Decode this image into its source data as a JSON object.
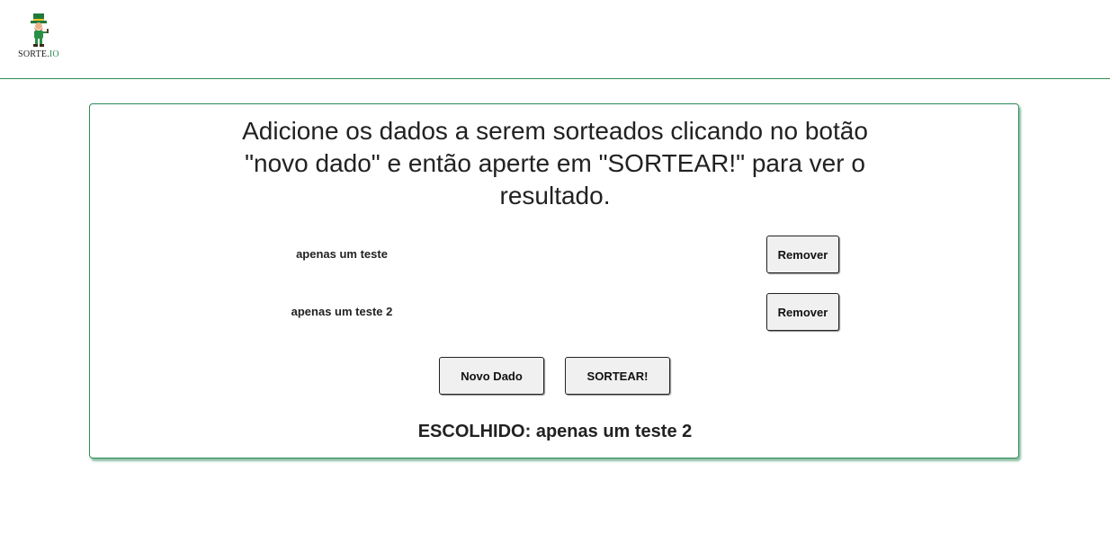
{
  "header": {
    "logo_text_main": "SORTE.",
    "logo_text_accent": "IO",
    "brand_color": "#2e8b57"
  },
  "main": {
    "instructions": "Adicione os dados a serem sorteados clicando no botão \"novo dado\" e então aperte em \"SORTEAR!\" para ver o resultado.",
    "items": [
      {
        "label": "apenas um teste",
        "remove_label": "Remover"
      },
      {
        "label": "apenas um teste 2",
        "remove_label": "Remover"
      }
    ],
    "new_item_label": "Novo Dado",
    "draw_label": "SORTEAR!",
    "result_prefix": "ESCOLHIDO: ",
    "result_value": "apenas um teste 2"
  }
}
